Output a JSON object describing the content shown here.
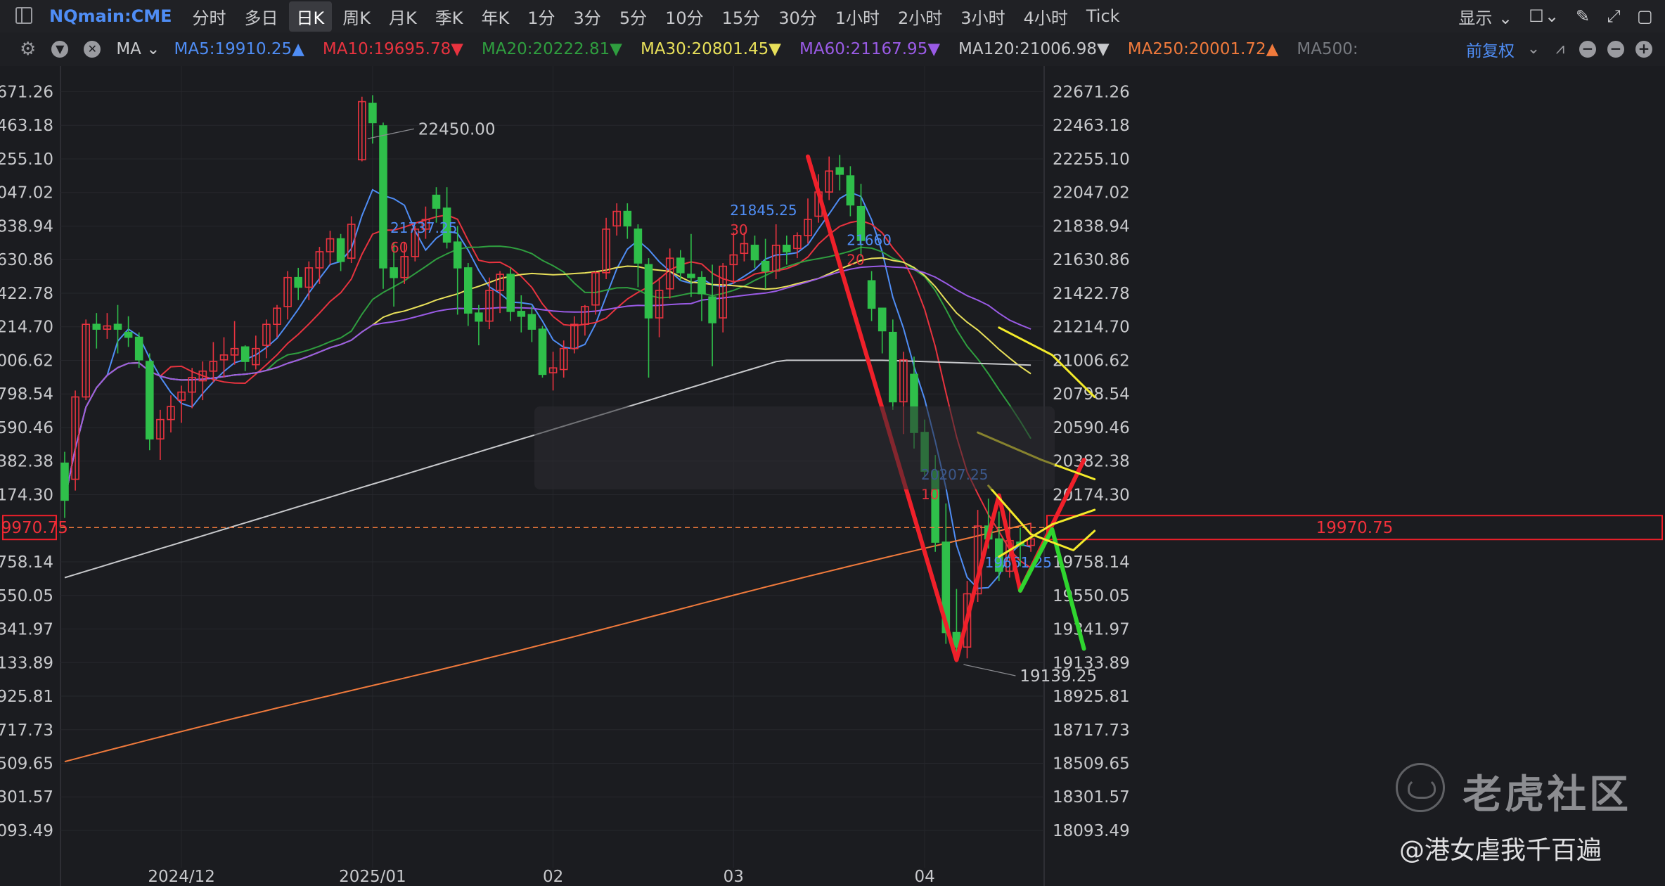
{
  "toolbar": {
    "symbol": "NQmain:CME",
    "periods": [
      "分时",
      "多日",
      "日K",
      "周K",
      "月K",
      "季K",
      "年K",
      "1分",
      "3分",
      "5分",
      "10分",
      "15分",
      "30分",
      "1小时",
      "2小时",
      "3小时",
      "4小时",
      "Tick"
    ],
    "active_period": "日K",
    "display_label": "显示"
  },
  "ma_bar": {
    "indicator": "MA",
    "items": [
      {
        "label": "MA5:19910.25▲",
        "color": "#4f8df5"
      },
      {
        "label": "MA10:19695.78▼",
        "color": "#e8333f"
      },
      {
        "label": "MA20:20222.81▼",
        "color": "#2f9e3f"
      },
      {
        "label": "MA30:20801.45▼",
        "color": "#e8e05a"
      },
      {
        "label": "MA60:21167.95▼",
        "color": "#9a5be6"
      },
      {
        "label": "MA120:21006.98▼",
        "color": "#c8c9cc"
      },
      {
        "label": "MA250:20001.72▲",
        "color": "#f07a3c"
      },
      {
        "label": "MA500:",
        "color": "#777a80"
      }
    ],
    "adjust_label": "前复权"
  },
  "chart_data": {
    "type": "candlestick",
    "symbol": "NQmain:CME",
    "period": "日K",
    "y_ticks": [
      22671.26,
      22463.18,
      22255.1,
      22047.02,
      21838.94,
      21630.86,
      21422.78,
      21214.7,
      21006.62,
      20798.54,
      20590.46,
      20382.38,
      20174.3,
      19970.75,
      19758.14,
      19550.05,
      19341.97,
      19133.89,
      18925.81,
      18717.73,
      18509.65,
      18301.57,
      18093.49
    ],
    "ylim": [
      18030,
      22810
    ],
    "x_labels": [
      {
        "label": "2024/12",
        "index": 11
      },
      {
        "label": "2025/01",
        "index": 29
      },
      {
        "label": "02",
        "index": 46
      },
      {
        "label": "03",
        "index": 63
      },
      {
        "label": "04",
        "index": 81
      }
    ],
    "current_price": 19970.75,
    "candles": [
      [
        20370,
        20140,
        20440,
        20030
      ],
      [
        20270,
        20780,
        20820,
        20200
      ],
      [
        20780,
        21230,
        21260,
        20760
      ],
      [
        21230,
        21200,
        21300,
        21080
      ],
      [
        21200,
        21220,
        21300,
        21140
      ],
      [
        21230,
        21200,
        21350,
        21050
      ],
      [
        21180,
        21150,
        21280,
        21090
      ],
      [
        21150,
        21010,
        21180,
        20960
      ],
      [
        21000,
        20520,
        21050,
        20450
      ],
      [
        20520,
        20640,
        20700,
        20390
      ],
      [
        20640,
        20720,
        20790,
        20560
      ],
      [
        20760,
        20810,
        20850,
        20620
      ],
      [
        20810,
        20900,
        20960,
        20710
      ],
      [
        20880,
        20940,
        21000,
        20760
      ],
      [
        20940,
        21000,
        21120,
        20870
      ],
      [
        21010,
        21040,
        21150,
        20900
      ],
      [
        21040,
        21080,
        21250,
        20980
      ],
      [
        21090,
        21000,
        21100,
        20940
      ],
      [
        20980,
        21080,
        21160,
        20950
      ],
      [
        21100,
        21230,
        21260,
        21020
      ],
      [
        21230,
        21330,
        21350,
        21150
      ],
      [
        21340,
        21520,
        21560,
        21260
      ],
      [
        21520,
        21460,
        21580,
        21380
      ],
      [
        21460,
        21580,
        21620,
        21380
      ],
      [
        21580,
        21680,
        21710,
        21480
      ],
      [
        21680,
        21760,
        21810,
        21600
      ],
      [
        21760,
        21620,
        21790,
        21560
      ],
      [
        21640,
        21850,
        21900,
        21610
      ],
      [
        22250,
        22610,
        22640,
        22240
      ],
      [
        22600,
        22480,
        22650,
        22350
      ],
      [
        22460,
        21580,
        22480,
        21450
      ],
      [
        21580,
        21520,
        21740,
        21340
      ],
      [
        21520,
        21650,
        21740,
        21480
      ],
      [
        21650,
        21820,
        21840,
        21620
      ],
      [
        21820,
        21880,
        21960,
        21760
      ],
      [
        22030,
        21950,
        22080,
        21860
      ],
      [
        21950,
        21740,
        22080,
        21700
      ],
      [
        21740,
        21580,
        21840,
        21290
      ],
      [
        21580,
        21300,
        21610,
        21220
      ],
      [
        21300,
        21250,
        21350,
        21100
      ],
      [
        21250,
        21440,
        21520,
        21200
      ],
      [
        21440,
        21540,
        21560,
        21300
      ],
      [
        21540,
        21310,
        21580,
        21250
      ],
      [
        21310,
        21280,
        21410,
        21180
      ],
      [
        21290,
        21200,
        21340,
        21120
      ],
      [
        21200,
        20920,
        21220,
        20900
      ],
      [
        20930,
        20960,
        21060,
        20820
      ],
      [
        20950,
        21080,
        21130,
        20900
      ],
      [
        21080,
        21230,
        21280,
        21050
      ],
      [
        21230,
        21340,
        21350,
        21160
      ],
      [
        21350,
        21550,
        21560,
        21290
      ],
      [
        21550,
        21820,
        21890,
        21510
      ],
      [
        21840,
        21930,
        21980,
        21780
      ],
      [
        21930,
        21840,
        21980,
        21760
      ],
      [
        21820,
        21610,
        21850,
        21460
      ],
      [
        21600,
        21270,
        21640,
        20900
      ],
      [
        21270,
        21440,
        21520,
        21150
      ],
      [
        21450,
        21640,
        21700,
        21390
      ],
      [
        21640,
        21550,
        21690,
        21500
      ],
      [
        21540,
        21520,
        21790,
        21400
      ],
      [
        21520,
        21420,
        21560,
        21250
      ],
      [
        21400,
        21240,
        21600,
        20970
      ],
      [
        21270,
        21590,
        21610,
        21180
      ],
      [
        21600,
        21660,
        21800,
        21480
      ],
      [
        21670,
        21730,
        21800,
        21620
      ],
      [
        21720,
        21630,
        21780,
        21580
      ],
      [
        21620,
        21560,
        21760,
        21450
      ],
      [
        21560,
        21720,
        21850,
        21510
      ],
      [
        21720,
        21680,
        21780,
        21600
      ],
      [
        21700,
        21780,
        21800,
        21640
      ],
      [
        21780,
        21880,
        22010,
        21730
      ],
      [
        21900,
        22050,
        22160,
        21860
      ],
      [
        22050,
        22180,
        22270,
        22000
      ],
      [
        22200,
        22160,
        22280,
        22060
      ],
      [
        22150,
        21970,
        22210,
        21900
      ],
      [
        21960,
        21750,
        22100,
        21650
      ],
      [
        21500,
        21330,
        21560,
        21250
      ],
      [
        21330,
        21190,
        21310,
        21050
      ],
      [
        21180,
        20750,
        21260,
        20700
      ],
      [
        20750,
        21010,
        21060,
        20550
      ],
      [
        20920,
        20560,
        21030,
        20460
      ],
      [
        20560,
        20320,
        20640,
        20290
      ],
      [
        20320,
        19880,
        20420,
        19820
      ],
      [
        19880,
        19320,
        20120,
        19250
      ],
      [
        19320,
        19230,
        19590,
        19170
      ],
      [
        19230,
        19560,
        19640,
        19160
      ],
      [
        19560,
        19980,
        20080,
        19510
      ],
      [
        19980,
        19900,
        20150,
        19840
      ],
      [
        19900,
        19700,
        20070,
        19640
      ],
      [
        19700,
        19890,
        20090,
        19660
      ],
      [
        19880,
        19860,
        19970,
        19730
      ],
      [
        19860,
        19900,
        20000,
        19820
      ]
    ],
    "ma_lines": [
      {
        "name": "MA5",
        "color": "#4f8df5"
      },
      {
        "name": "MA10",
        "color": "#e8333f"
      },
      {
        "name": "MA20",
        "color": "#2f9e3f"
      },
      {
        "name": "MA30",
        "color": "#e8e05a"
      },
      {
        "name": "MA60",
        "color": "#9a5be6"
      },
      {
        "name": "MA120",
        "color": "#c8c9cc"
      },
      {
        "name": "MA250",
        "color": "#f07a3c"
      }
    ],
    "annotations": [
      {
        "text": "22450.00",
        "color": "#c8c9cc",
        "index": 28,
        "value": 22450.0
      },
      {
        "text": "21737.25",
        "color": "#4f8df5",
        "index": 30,
        "value": 21737.25
      },
      {
        "text": "60",
        "color": "#e8333f",
        "index": 30,
        "value": 21737.25
      },
      {
        "text": "21845.25",
        "color": "#4f8df5",
        "index": 62,
        "value": 21845.25
      },
      {
        "text": "30",
        "color": "#e8333f",
        "index": 62,
        "value": 21845.25
      },
      {
        "text": "21660",
        "color": "#4f8df5",
        "index": 73,
        "value": 21660
      },
      {
        "text": "20",
        "color": "#e8333f",
        "index": 73,
        "value": 21660
      },
      {
        "text": "20207.25",
        "color": "#4f8df5",
        "index": 80,
        "value": 20207.25
      },
      {
        "text": "10",
        "color": "#e8333f",
        "index": 80,
        "value": 20207.25
      },
      {
        "text": "19661.25",
        "color": "#4f8df5",
        "index": 86,
        "value": 19661.25
      },
      {
        "text": "19139.25",
        "color": "#c8c9cc",
        "index": 84,
        "value": 19139.25
      }
    ],
    "drawings": [
      {
        "color": "#f0202a",
        "points": [
          [
            22270,
            70
          ],
          [
            19150,
            84
          ],
          [
            20170,
            88
          ],
          [
            19580,
            90
          ],
          [
            20390,
            96
          ]
        ]
      },
      {
        "color": "#2fd52f",
        "points": [
          [
            19580,
            90
          ],
          [
            19960,
            93
          ],
          [
            19220,
            96
          ]
        ]
      },
      {
        "color": "#f3ea2a",
        "points": [
          [
            21210,
            88
          ],
          [
            21040,
            93
          ],
          [
            20780,
            97
          ]
        ]
      },
      {
        "color": "#f3ea2a",
        "points": [
          [
            20230,
            87
          ],
          [
            19930,
            91
          ],
          [
            19830,
            95
          ],
          [
            19950,
            97
          ]
        ]
      },
      {
        "color": "#f3ea2a",
        "points": [
          [
            19790,
            88
          ],
          [
            19990,
            93
          ],
          [
            20080,
            97
          ]
        ]
      },
      {
        "color": "#f3ea2a",
        "points": [
          [
            20560,
            86
          ],
          [
            20390,
            92
          ],
          [
            20270,
            97
          ]
        ]
      }
    ]
  },
  "watermark": {
    "brand": "老虎社区",
    "user": "@港女虐我千百遍"
  }
}
